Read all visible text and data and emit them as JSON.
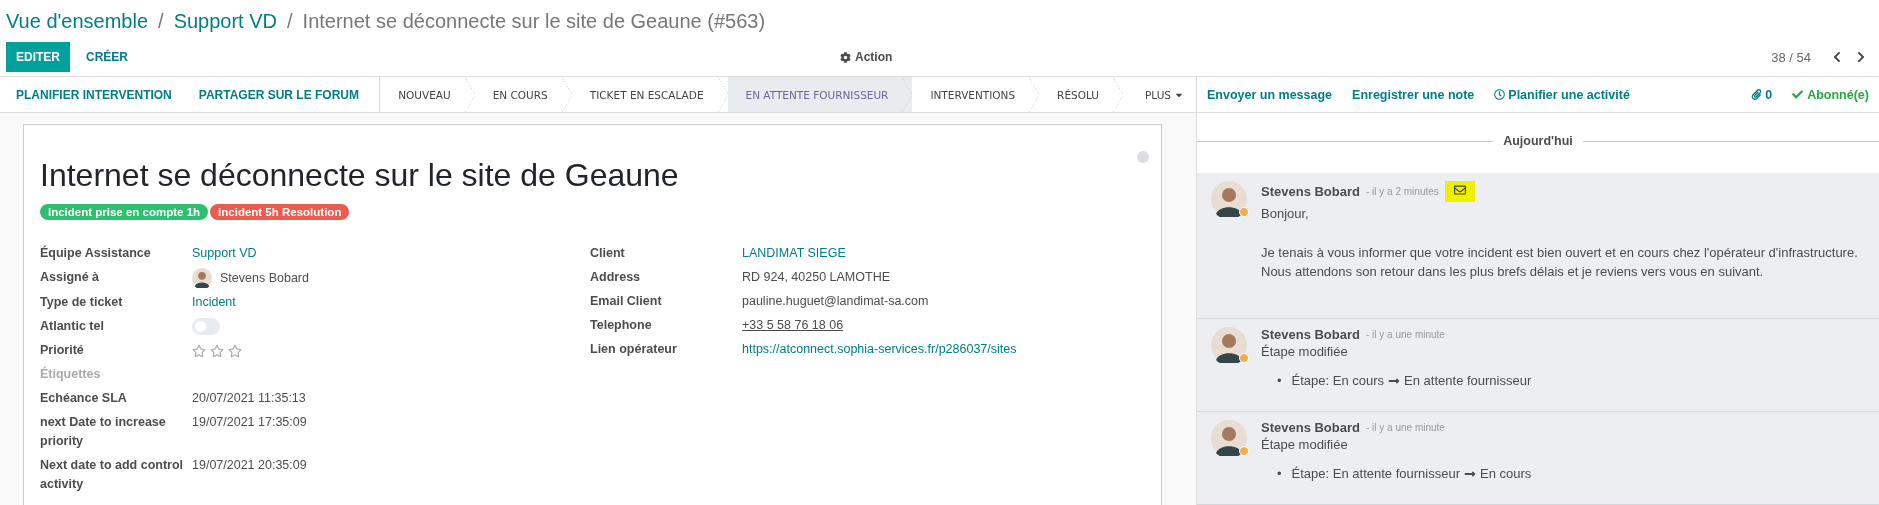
{
  "breadcrumbs": [
    {
      "label": "Vue d'ensemble",
      "kind": "link"
    },
    {
      "label": "Support VD",
      "kind": "link"
    },
    {
      "label": "Internet se déconnecte sur le site de Geaune (#563)",
      "kind": "current"
    }
  ],
  "separator": "/",
  "buttons": [
    {
      "label": "EDITER",
      "kind": "primary"
    },
    {
      "label": "CRÉER",
      "kind": "secondary"
    }
  ],
  "action": "Action",
  "pager": "38 / 54",
  "header_buttons": [
    "PLANIFIER INTERVENTION",
    "PARTAGER SUR LE FORUM"
  ],
  "stages": [
    {
      "label": "NOUVEAU",
      "selected": false
    },
    {
      "label": "EN COURS",
      "selected": false
    },
    {
      "label": "TICKET EN ESCALADE",
      "selected": false
    },
    {
      "label": "EN ATTENTE FOURNISSEUR",
      "selected": true
    },
    {
      "label": "INTERVENTIONS",
      "selected": false
    },
    {
      "label": "RÉSOLU",
      "selected": false
    }
  ],
  "more_stages": "PLUS",
  "ticket": {
    "title": "Internet se déconnecte sur le site de Geaune",
    "tags": [
      {
        "label": "Incident prise en compte 1h",
        "color": "#2fbf71"
      },
      {
        "label": "incident 5h Resolution",
        "color": "#ec5b4f"
      }
    ],
    "left_fields": [
      {
        "label": "Équipe Assistance",
        "kind": "link",
        "value": "Support VD"
      },
      {
        "label": "Assigné à",
        "kind": "user",
        "value": "Stevens Bobard"
      },
      {
        "label": "Type de ticket",
        "kind": "link",
        "value": "Incident"
      },
      {
        "label": "Atlantic tel",
        "kind": "toggle",
        "on": false
      },
      {
        "label": "Priorité",
        "kind": "stars",
        "stars": 0
      },
      {
        "label": "Étiquettes",
        "kind": "empty"
      },
      {
        "label": "Echéance SLA",
        "kind": "text",
        "value": "20/07/2021 11:35:13"
      },
      {
        "label": "next Date to increase priority",
        "kind": "text",
        "value": "19/07/2021 17:35:09"
      },
      {
        "label": "Next date to add control activity",
        "kind": "text",
        "value": "19/07/2021 20:35:09"
      }
    ],
    "right_fields": [
      {
        "label": "Client",
        "kind": "link",
        "value": "LANDIMAT SIEGE"
      },
      {
        "label": "Address",
        "kind": "text",
        "value": "RD 924, 40250 LAMOTHE"
      },
      {
        "label": "Email Client",
        "kind": "text",
        "value": "pauline.huguet@landimat-sa.com"
      },
      {
        "label": "Telephone",
        "kind": "phone",
        "value": "+33 5 58 76 18 06"
      },
      {
        "label": "Lien opérateur",
        "kind": "link",
        "value": "https://atconnect.sophia-services.fr/p286037/sites"
      }
    ]
  },
  "chatter": {
    "actions": [
      "Envoyer un message",
      "Enregistrer une note",
      "Planifier une activité"
    ],
    "attachments": "0",
    "follow": "Abonné(e)",
    "day": "Aujourd'hui",
    "messages": [
      {
        "kind": "email",
        "author": "Stevens Bobard",
        "time": "- il y a 2 minutes",
        "paragraphs": [
          "Bonjour,",
          "Je tenais à vous informer que votre incident est bien ouvert et en cours chez l'opérateur d'infrastructure. Nous attendons son retour dans les plus brefs délais et je reviens vers vous en suivant."
        ]
      },
      {
        "kind": "tracking",
        "author": "Stevens Bobard",
        "time": "- il y a une minute",
        "title": "Étape modifiée",
        "change": {
          "bullet": "•",
          "field": "Étape:",
          "from": "En cours",
          "to": "En attente fournisseur"
        }
      },
      {
        "kind": "tracking",
        "author": "Stevens Bobard",
        "time": "- il y a une minute",
        "title": "Étape modifiée",
        "change": {
          "bullet": "•",
          "field": "Étape:",
          "from": "En attente fournisseur",
          "to": "En cours"
        }
      }
    ]
  }
}
